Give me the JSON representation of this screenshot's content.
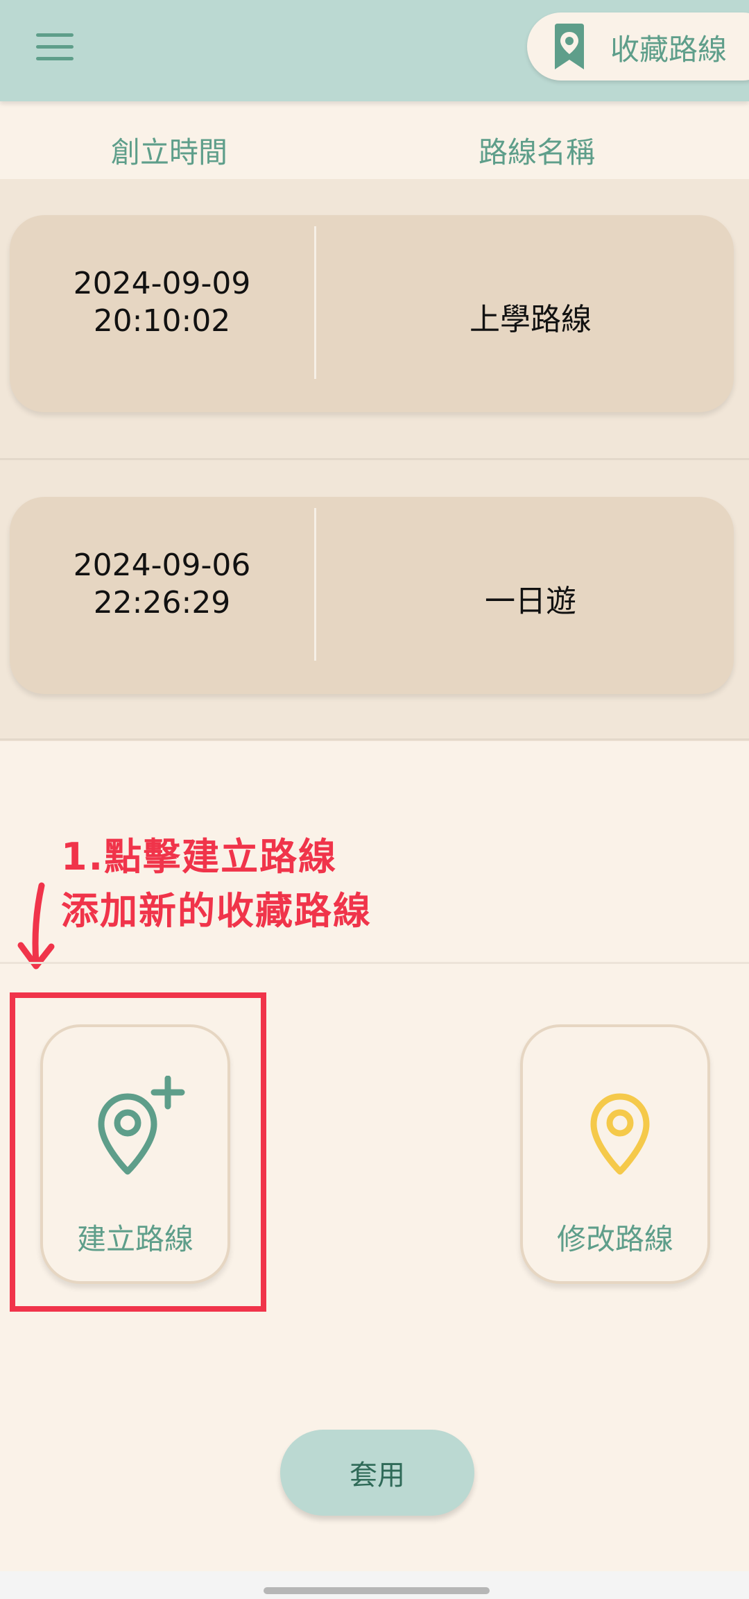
{
  "header": {
    "title": "收藏路線",
    "menu_icon": "hamburger-menu-icon",
    "title_icon": "bookmark-pin-icon",
    "background_color": "#bbd9d2",
    "accent_color": "#5e9e8a"
  },
  "columns": {
    "created_time": "創立時間",
    "route_name": "路線名稱"
  },
  "routes": [
    {
      "date": "2024-09-09",
      "time": "20:10:02",
      "name": "上學路線"
    },
    {
      "date": "2024-09-06",
      "time": "22:26:29",
      "name": "一日遊"
    }
  ],
  "annotation": {
    "line1": "1.點擊建立路線",
    "line2": "添加新的收藏路線",
    "color": "#f0344a",
    "arrow_icon": "arrow-down-icon"
  },
  "actions": {
    "create": {
      "label": "建立路線",
      "icon": "add-location-pin-icon",
      "color": "#5e9e8a"
    },
    "edit": {
      "label": "修改路線",
      "icon": "location-pin-icon",
      "color": "#f5c94a"
    }
  },
  "apply_button": {
    "label": "套用"
  }
}
